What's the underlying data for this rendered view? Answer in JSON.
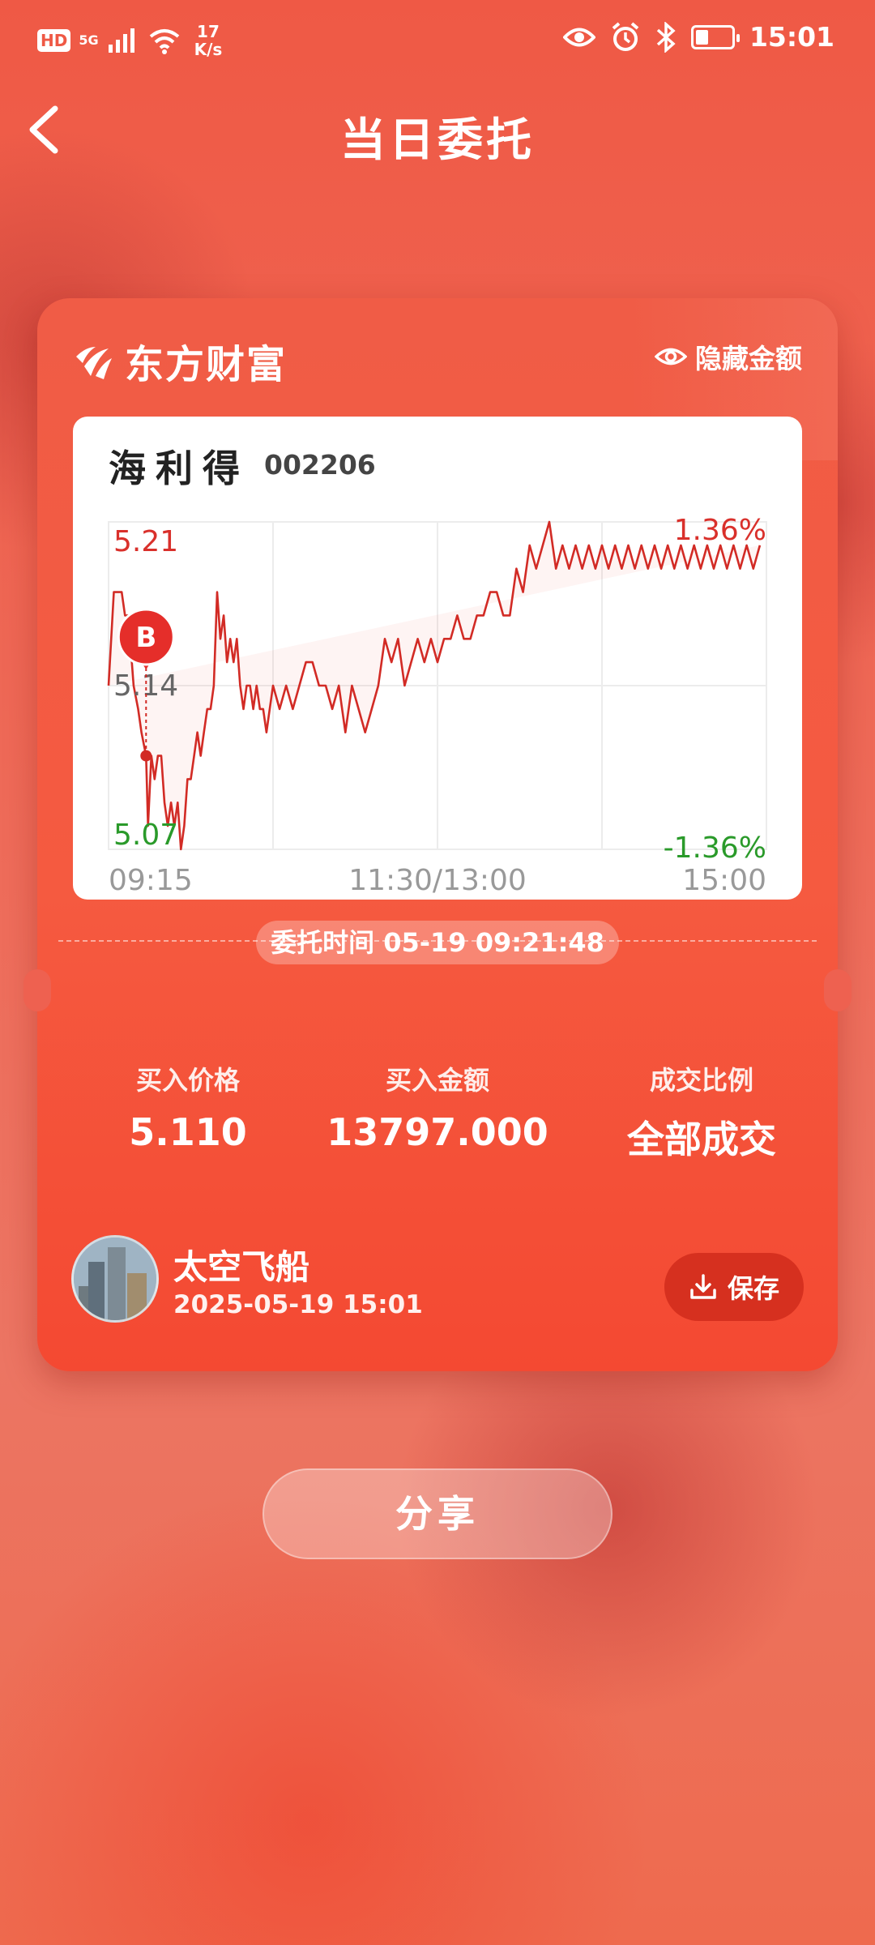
{
  "status_bar": {
    "hd": "HD",
    "network": "5G",
    "speed_value": "17",
    "speed_unit": "K/s",
    "time": "15:01",
    "battery_level": 0.35
  },
  "header": {
    "title": "当日委托"
  },
  "card": {
    "brand": "东方财富",
    "hide_amount_label": "隐藏金额",
    "stock": {
      "name": "海利得",
      "code": "002206"
    },
    "order_time_text": "委托时间 05-19 09:21:48",
    "stats": [
      {
        "label": "买入价格",
        "value": "5.110"
      },
      {
        "label": "买入金额",
        "value": "13797.000"
      },
      {
        "label": "成交比例",
        "value": "全部成交"
      }
    ],
    "user": {
      "name": "太空飞船",
      "datetime": "2025-05-19 15:01"
    },
    "save_label": "保存"
  },
  "share_label": "分享",
  "colors": {
    "up": "#d9302b",
    "down": "#2a9a2a",
    "line": "#d22b25",
    "background": "#ef5945"
  },
  "chart_data": {
    "type": "line",
    "y_labels": [
      "5.21",
      "5.14",
      "5.07"
    ],
    "pct_labels": [
      "1.36%",
      "-1.36%"
    ],
    "x_labels": [
      "09:15",
      "11:30/13:00",
      "15:00"
    ],
    "ylim": [
      5.07,
      5.21
    ],
    "marker": {
      "label": "B",
      "price": 5.11,
      "time_fraction": 0.057
    },
    "grid": true,
    "x": [
      0,
      0.008,
      0.02,
      0.025,
      0.03,
      0.038,
      0.045,
      0.05,
      0.057,
      0.06,
      0.065,
      0.07,
      0.075,
      0.08,
      0.085,
      0.09,
      0.095,
      0.1,
      0.105,
      0.11,
      0.115,
      0.12,
      0.125,
      0.13,
      0.135,
      0.14,
      0.145,
      0.15,
      0.155,
      0.16,
      0.165,
      0.17,
      0.175,
      0.18,
      0.185,
      0.19,
      0.195,
      0.2,
      0.205,
      0.21,
      0.215,
      0.22,
      0.225,
      0.23,
      0.235,
      0.24,
      0.245,
      0.25,
      0.26,
      0.27,
      0.28,
      0.29,
      0.3,
      0.31,
      0.32,
      0.33,
      0.34,
      0.35,
      0.36,
      0.37,
      0.38,
      0.39,
      0.4,
      0.41,
      0.42,
      0.43,
      0.44,
      0.45,
      0.46,
      0.47,
      0.48,
      0.49,
      0.5,
      0.51,
      0.52,
      0.53,
      0.54,
      0.55,
      0.56,
      0.57,
      0.58,
      0.59,
      0.6,
      0.61,
      0.62,
      0.63,
      0.64,
      0.65,
      0.66,
      0.67,
      0.68,
      0.69,
      0.7,
      0.71,
      0.72,
      0.73,
      0.74,
      0.75,
      0.76,
      0.77,
      0.78,
      0.79,
      0.8,
      0.81,
      0.82,
      0.83,
      0.84,
      0.85,
      0.86,
      0.87,
      0.88,
      0.89,
      0.9,
      0.91,
      0.92,
      0.93,
      0.94,
      0.95,
      0.96,
      0.97,
      0.98,
      0.99,
      1.0
    ],
    "y": [
      5.14,
      5.18,
      5.18,
      5.17,
      5.17,
      5.14,
      5.13,
      5.12,
      5.11,
      5.08,
      5.11,
      5.1,
      5.11,
      5.11,
      5.09,
      5.08,
      5.09,
      5.08,
      5.09,
      5.07,
      5.08,
      5.1,
      5.1,
      5.11,
      5.12,
      5.11,
      5.12,
      5.13,
      5.13,
      5.14,
      5.18,
      5.16,
      5.17,
      5.15,
      5.16,
      5.15,
      5.16,
      5.14,
      5.13,
      5.14,
      5.14,
      5.13,
      5.14,
      5.13,
      5.13,
      5.12,
      5.13,
      5.14,
      5.13,
      5.14,
      5.13,
      5.14,
      5.15,
      5.15,
      5.14,
      5.14,
      5.13,
      5.14,
      5.12,
      5.14,
      5.13,
      5.12,
      5.13,
      5.14,
      5.16,
      5.15,
      5.16,
      5.14,
      5.15,
      5.16,
      5.15,
      5.16,
      5.15,
      5.16,
      5.16,
      5.17,
      5.16,
      5.16,
      5.17,
      5.17,
      5.18,
      5.18,
      5.17,
      5.17,
      5.19,
      5.18,
      5.2,
      5.19,
      5.2,
      5.21,
      5.19,
      5.2,
      5.19,
      5.2,
      5.19,
      5.2,
      5.19,
      5.2,
      5.19,
      5.2,
      5.19,
      5.2,
      5.19,
      5.2,
      5.19,
      5.2,
      5.19,
      5.2,
      5.19,
      5.2,
      5.19,
      5.2,
      5.19,
      5.2,
      5.19,
      5.2,
      5.19,
      5.2,
      5.19,
      5.2,
      5.19,
      5.2
    ]
  }
}
